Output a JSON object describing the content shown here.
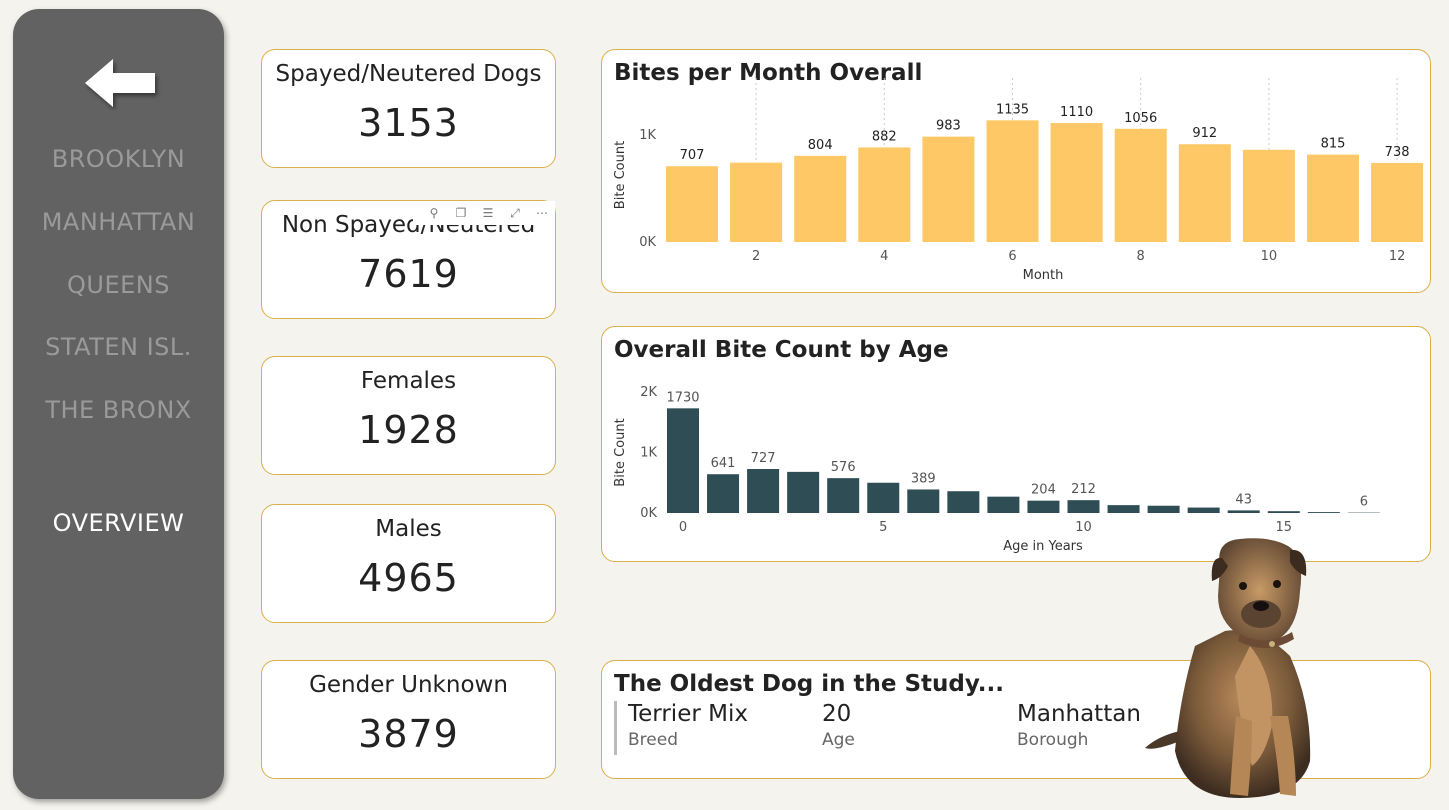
{
  "sidebar": {
    "nav": [
      "BROOKLYN",
      "MANHATTAN",
      "QUEENS",
      "STATEN ISL.",
      "THE BRONX"
    ],
    "active": "OVERVIEW"
  },
  "kpis": [
    {
      "label": "Spayed/Neutered Dogs",
      "value": "3153"
    },
    {
      "label": "Non Spayed/Neutered",
      "value": "7619"
    },
    {
      "label": "Females",
      "value": "1928"
    },
    {
      "label": "Males",
      "value": "4965"
    },
    {
      "label": "Gender Unknown",
      "value": "3879"
    }
  ],
  "colors": {
    "bars_month": "#fdc865",
    "bars_age": "#2f4d55",
    "border": "#d9b04a",
    "sidebar": "#626262"
  },
  "chart_data": [
    {
      "type": "bar",
      "title": "Bites per Month Overall",
      "xlabel": "Month",
      "ylabel": "Bite Count",
      "x": [
        1,
        2,
        3,
        4,
        5,
        6,
        7,
        8,
        9,
        10,
        11,
        12
      ],
      "values": [
        707,
        740,
        804,
        882,
        983,
        1135,
        1110,
        1056,
        912,
        860,
        815,
        738
      ],
      "data_labels": {
        "1": "707",
        "3": "804",
        "4": "882",
        "5": "983",
        "6": "1135",
        "7": "1110",
        "8": "1056",
        "9": "912",
        "11": "815",
        "12": "738"
      },
      "xticks": [
        "2",
        "4",
        "6",
        "8",
        "10",
        "12"
      ],
      "yticks": [
        "0K",
        "1K"
      ],
      "ylim": [
        0,
        1250
      ],
      "grid": true
    },
    {
      "type": "bar",
      "title": "Overall Bite Count by Age",
      "xlabel": "Age in Years",
      "ylabel": "Bite Count",
      "x": [
        0,
        1,
        2,
        3,
        4,
        5,
        6,
        7,
        8,
        9,
        10,
        11,
        12,
        13,
        14,
        15,
        16,
        17
      ],
      "values": [
        1730,
        641,
        727,
        680,
        576,
        500,
        389,
        360,
        270,
        204,
        212,
        130,
        120,
        90,
        43,
        30,
        15,
        6
      ],
      "data_labels": {
        "0": "1730",
        "1": "641",
        "2": "727",
        "4": "576",
        "6": "389",
        "9": "204",
        "10": "212",
        "14": "43",
        "17": "6"
      },
      "xticks": [
        "0",
        "5",
        "10",
        "15"
      ],
      "yticks": [
        "0K",
        "1K",
        "2K"
      ],
      "ylim": [
        0,
        2000
      ]
    }
  ],
  "oldest": {
    "title": "The Oldest Dog in the Study...",
    "fields": [
      {
        "value": "Terrier Mix",
        "caption": "Breed"
      },
      {
        "value": "20",
        "caption": "Age"
      },
      {
        "value": "Manhattan",
        "caption": "Borough"
      }
    ]
  }
}
